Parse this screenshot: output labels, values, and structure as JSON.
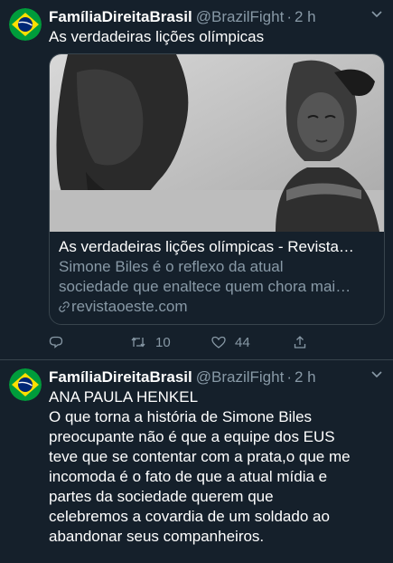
{
  "tweets": [
    {
      "name": "FamíliaDireitaBrasil",
      "handle": "@BrazilFight",
      "separator": "·",
      "time": "2 h",
      "text_lines": [
        "As verdadeiras lições olímpicas"
      ],
      "card": {
        "title": "As verdadeiras lições olímpicas - Revista…",
        "description_lines": [
          "Simone Biles é o reflexo da atual",
          "sociedade que enaltece quem chora mai…"
        ],
        "domain": "revistaoeste.com"
      },
      "actions": {
        "reply_count": "",
        "retweet_count": "10",
        "like_count": "44"
      }
    },
    {
      "name": "FamíliaDireitaBrasil",
      "handle": "@BrazilFight",
      "separator": "·",
      "time": "2 h",
      "text_lines": [
        "ANA PAULA HENKEL",
        "O que torna a história de Simone Biles",
        "preocupante não é que a equipe dos EUS",
        "teve que se contentar com a prata,o que me",
        "incomoda é o fato de que a atual mídia e",
        "partes da sociedade querem que",
        "celebremos a covardia de um soldado ao",
        "abandonar seus companheiros."
      ]
    }
  ],
  "colors": {
    "background": "#15202b",
    "secondary_text": "#8899a6",
    "border": "#38444d"
  },
  "icons": [
    "reply-icon",
    "retweet-icon",
    "like-icon",
    "share-icon",
    "more-icon",
    "link-icon"
  ]
}
